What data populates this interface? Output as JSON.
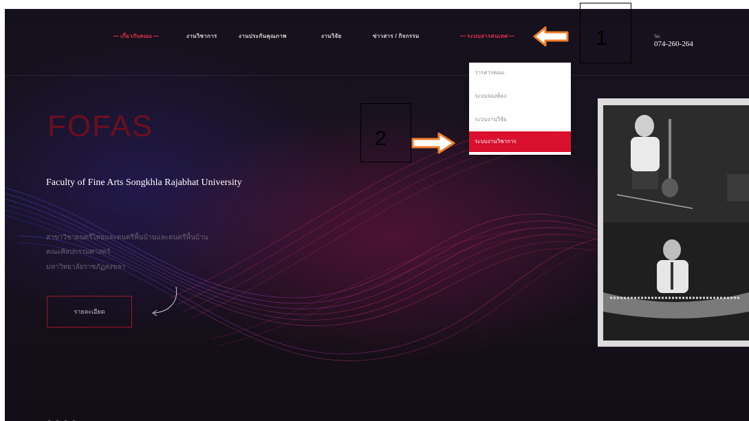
{
  "nav": {
    "items": [
      {
        "label": "เกี่ยวกับคณะ",
        "active": true
      },
      {
        "label": "งานวิชาการ",
        "active": false
      },
      {
        "label": "งานประกันคุณภาพ",
        "active": false
      },
      {
        "label": "งานวิจัย",
        "active": false
      },
      {
        "label": "ข่าวสาร / กิจกรรม",
        "active": false
      },
      {
        "label": "ระบบสารสนเทศ",
        "active": true
      }
    ],
    "tel_label": "Tel.",
    "tel_number": "074-260-264"
  },
  "dropdown": {
    "items": [
      {
        "label": "วารสารคณะ",
        "active": false
      },
      {
        "label": "ระบบจองห้อง",
        "active": false
      },
      {
        "label": "ระบบงานวิจัย",
        "active": false
      },
      {
        "label": "ระบบงานวิชาการ",
        "active": true
      }
    ]
  },
  "hero": {
    "title": "FOFAS",
    "subtitle": "Faculty of Fine Arts Songkhla Rajabhat University",
    "description_lines": [
      "สาขาวิชาดนตรีไทยและดนตรีพื้นบ้านและดนตรีพื้นบ้าน",
      "คณะศิลปกรรมศาสตร์",
      "มหาวิทยาลัยราชภัฏสงขลา"
    ],
    "detail_button": "รายละเอียด"
  },
  "annotations": [
    {
      "number": "1"
    },
    {
      "number": "2"
    }
  ],
  "colors": {
    "accent_red": "#d9112e",
    "annotation_arrow": "#f07d2a"
  }
}
